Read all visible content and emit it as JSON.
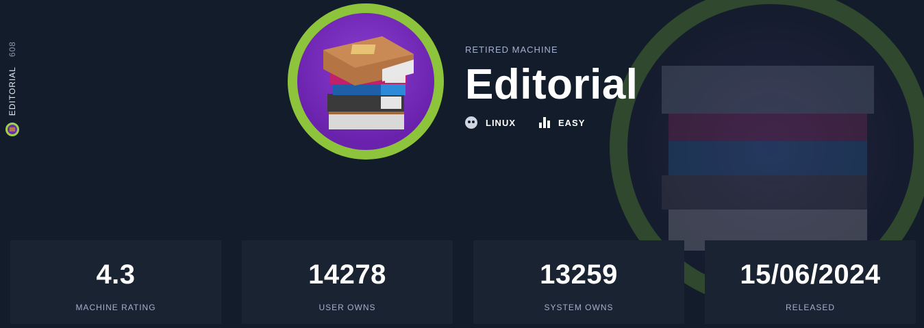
{
  "side": {
    "name": "EDITORIAL",
    "number": "608"
  },
  "header": {
    "eyebrow": "RETIRED MACHINE",
    "title": "Editorial",
    "os": "LINUX",
    "difficulty": "EASY"
  },
  "stats": [
    {
      "value": "4.3",
      "label": "MACHINE RATING"
    },
    {
      "value": "14278",
      "label": "USER OWNS"
    },
    {
      "value": "13259",
      "label": "SYSTEM OWNS"
    },
    {
      "value": "15/06/2024",
      "label": "RELEASED"
    }
  ],
  "colors": {
    "accent_green": "#8dc43c",
    "avatar_purple": "#6a22ad",
    "background": "#131c2a",
    "card": "#1a2332"
  }
}
